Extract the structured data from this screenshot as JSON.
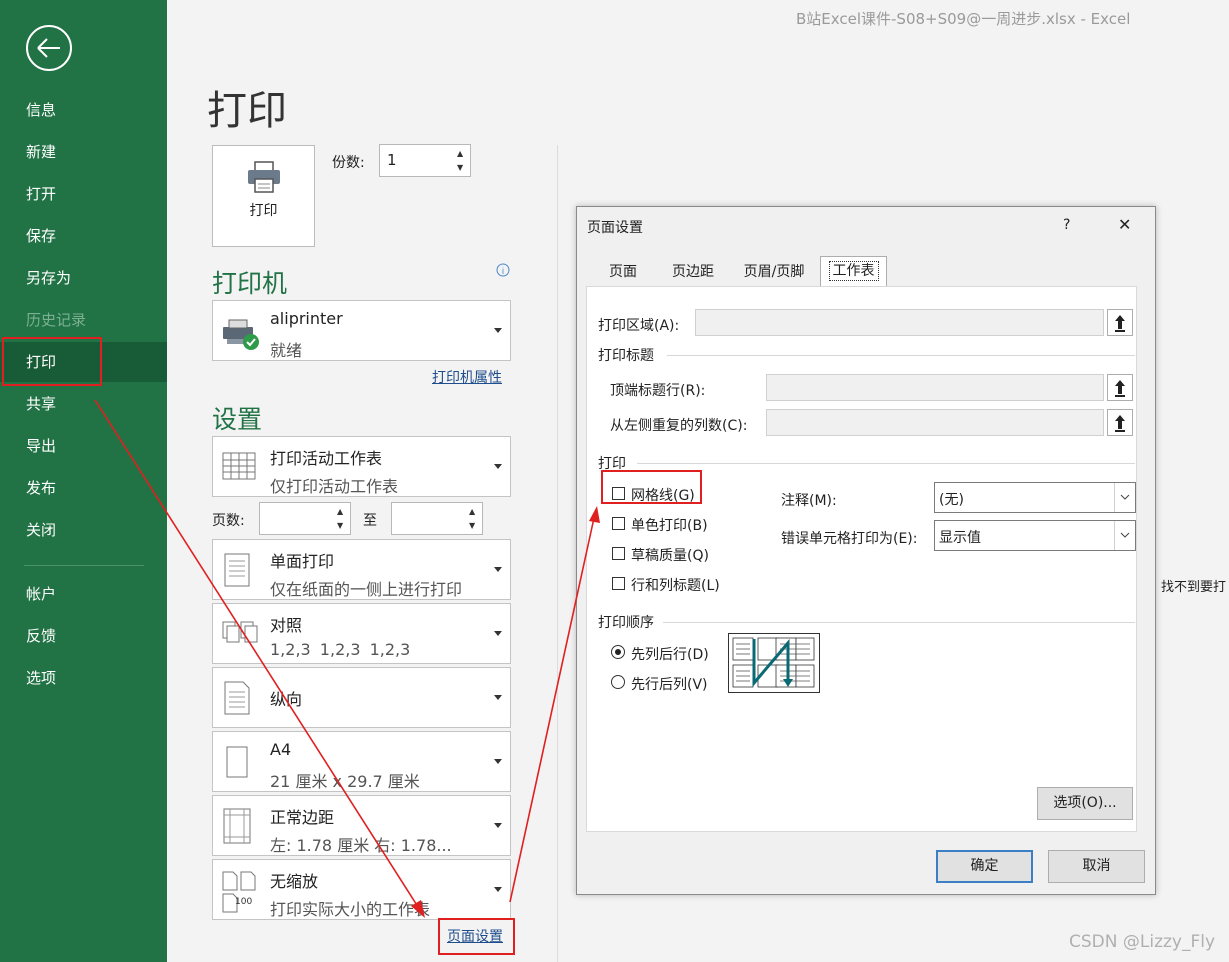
{
  "window_title": "B站Excel课件-S08+S09@一周进步.xlsx  -  Excel",
  "sidebar": {
    "items": [
      {
        "label": "信息"
      },
      {
        "label": "新建"
      },
      {
        "label": "打开"
      },
      {
        "label": "保存"
      },
      {
        "label": "另存为"
      },
      {
        "label": "历史记录"
      },
      {
        "label": "打印"
      },
      {
        "label": "共享"
      },
      {
        "label": "导出"
      },
      {
        "label": "发布"
      },
      {
        "label": "关闭"
      },
      {
        "label": "帐户"
      },
      {
        "label": "反馈"
      },
      {
        "label": "选项"
      }
    ]
  },
  "main": {
    "title": "打印",
    "print_button": "打印",
    "copies_label": "份数:",
    "copies_value": "1",
    "printer_heading": "打印机",
    "printer_name": "aliprinter",
    "printer_status": "就绪",
    "printer_properties": "打印机属性",
    "settings_heading": "设置",
    "settings": [
      {
        "title": "打印活动工作表",
        "subtitle": "仅打印活动工作表"
      },
      {
        "title": "单面打印",
        "subtitle": "仅在纸面的一侧上进行打印"
      },
      {
        "title": "对照",
        "subtitle": "1,2,3    1,2,3    1,2,3"
      },
      {
        "title": "纵向",
        "subtitle": ""
      },
      {
        "title": "A4",
        "subtitle": "21 厘米 x 29.7 厘米"
      },
      {
        "title": "正常边距",
        "subtitle": "左:  1.78 厘米    右:  1.78..."
      },
      {
        "title": "无缩放",
        "subtitle": "打印实际大小的工作表"
      }
    ],
    "pages_label": "页数:",
    "pages_to": "至",
    "page_setup_link": "页面设置",
    "scale_icon_text": "100",
    "side_text": "找不到要打"
  },
  "dialog": {
    "title": "页面设置",
    "help": "?",
    "close": "✕",
    "tabs": [
      "页面",
      "页边距",
      "页眉/页脚",
      "工作表"
    ],
    "print_area_label": "打印区域(A):",
    "print_titles_group": "打印标题",
    "rows_repeat_label": "顶端标题行(R):",
    "cols_repeat_label": "从左侧重复的列数(C):",
    "print_group": "打印",
    "checkboxes": [
      {
        "label": "网格线(G)",
        "checked": false
      },
      {
        "label": "单色打印(B)",
        "checked": false
      },
      {
        "label": "草稿质量(Q)",
        "checked": false
      },
      {
        "label": "行和列标题(L)",
        "checked": false
      }
    ],
    "comments_label": "注释(M):",
    "comments_value": "(无)",
    "errors_label": "错误单元格打印为(E):",
    "errors_value": "显示值",
    "order_group": "打印顺序",
    "order_options": [
      {
        "label": "先列后行(D)",
        "selected": true
      },
      {
        "label": "先行后列(V)",
        "selected": false
      }
    ],
    "options_button": "选项(O)...",
    "ok_button": "确定",
    "cancel_button": "取消"
  },
  "watermark": "CSDN @Lizzy_Fly",
  "colors": {
    "accent": "#217346",
    "annotation": "#e02020"
  }
}
